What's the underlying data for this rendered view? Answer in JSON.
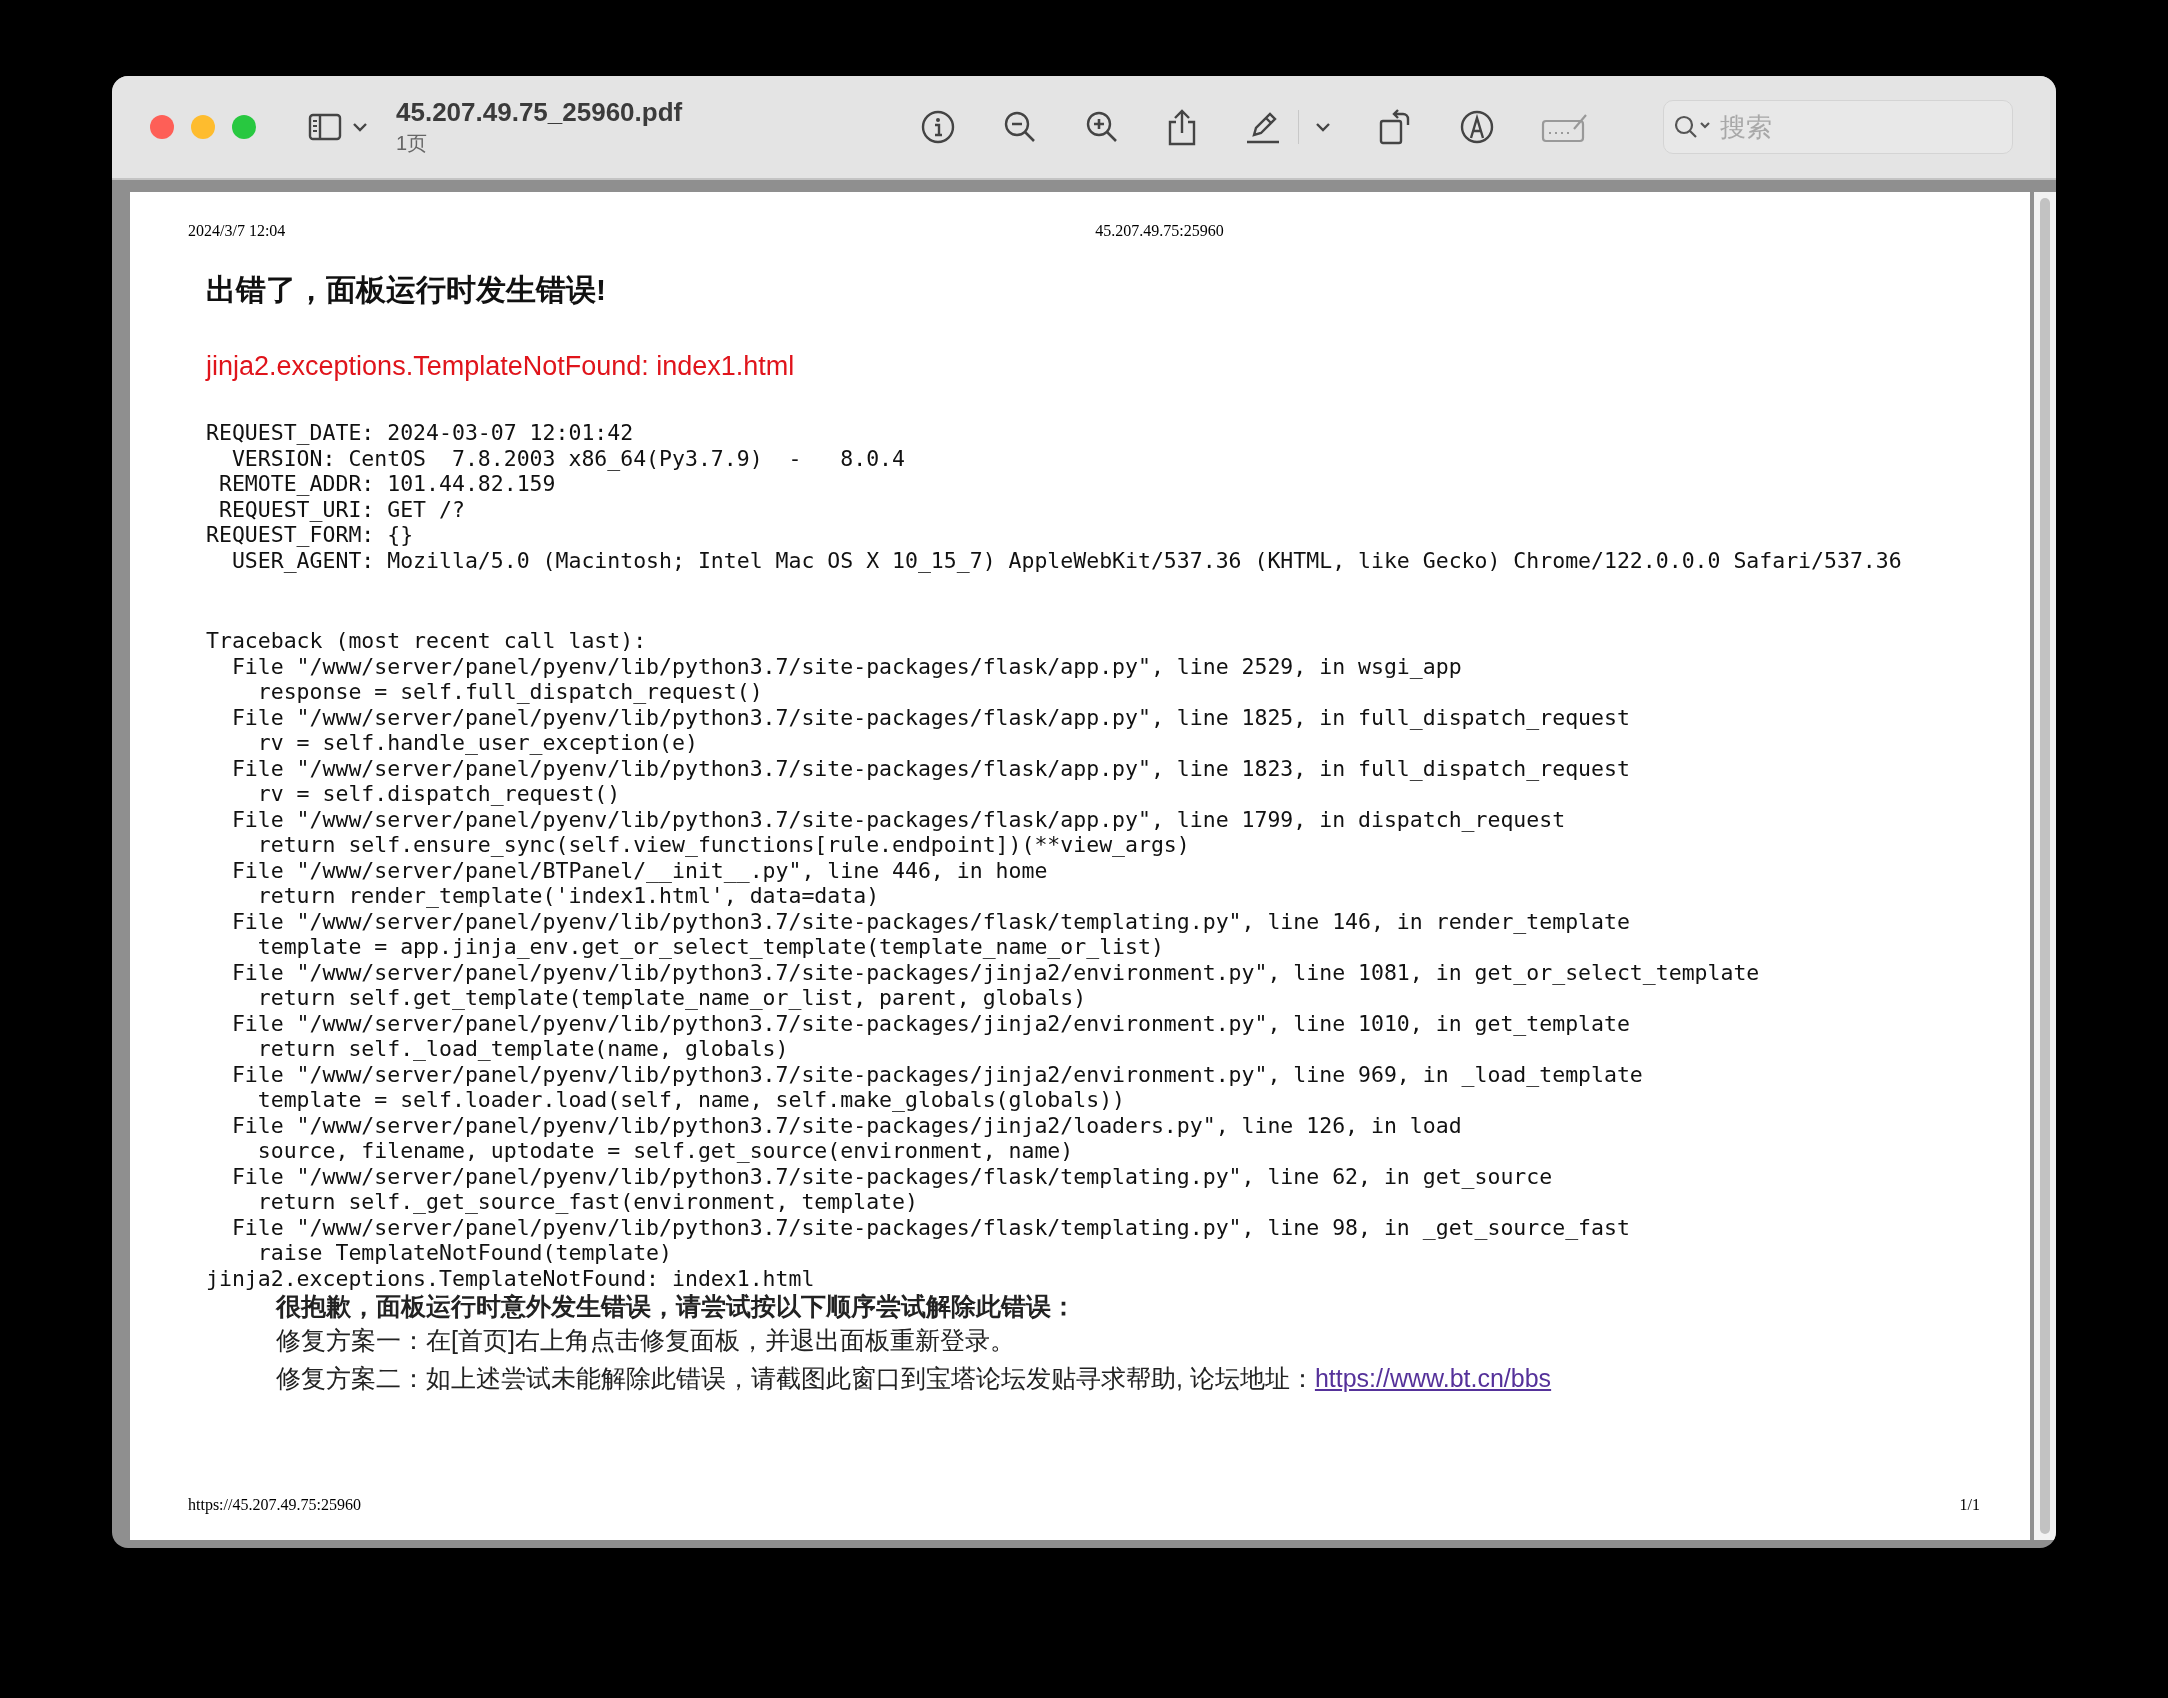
{
  "window": {
    "title": "45.207.49.75_25960.pdf",
    "subtitle": "1页"
  },
  "toolbar": {
    "search": {
      "placeholder": "搜索"
    }
  },
  "page": {
    "header_left": "2024/3/7 12:04",
    "header_center": "45.207.49.75:25960",
    "title": "出错了，面板运行时发生错误!",
    "error": "jinja2.exceptions.TemplateNotFound: index1.html",
    "request_info": [
      "REQUEST_DATE: 2024-03-07 12:01:42",
      "  VERSION: CentOS  7.8.2003 x86_64(Py3.7.9)  -   8.0.4",
      " REMOTE_ADDR: 101.44.82.159",
      " REQUEST_URI: GET /?",
      "REQUEST_FORM: {}",
      "  USER_AGENT: Mozilla/5.0 (Macintosh; Intel Mac OS X 10_15_7) AppleWebKit/537.36 (KHTML, like Gecko) Chrome/122.0.0.0 Safari/537.36"
    ],
    "traceback": [
      "Traceback (most recent call last):",
      "  File \"/www/server/panel/pyenv/lib/python3.7/site-packages/flask/app.py\", line 2529, in wsgi_app",
      "    response = self.full_dispatch_request()",
      "  File \"/www/server/panel/pyenv/lib/python3.7/site-packages/flask/app.py\", line 1825, in full_dispatch_request",
      "    rv = self.handle_user_exception(e)",
      "  File \"/www/server/panel/pyenv/lib/python3.7/site-packages/flask/app.py\", line 1823, in full_dispatch_request",
      "    rv = self.dispatch_request()",
      "  File \"/www/server/panel/pyenv/lib/python3.7/site-packages/flask/app.py\", line 1799, in dispatch_request",
      "    return self.ensure_sync(self.view_functions[rule.endpoint])(**view_args)",
      "  File \"/www/server/panel/BTPanel/__init__.py\", line 446, in home",
      "    return render_template('index1.html', data=data)",
      "  File \"/www/server/panel/pyenv/lib/python3.7/site-packages/flask/templating.py\", line 146, in render_template",
      "    template = app.jinja_env.get_or_select_template(template_name_or_list)",
      "  File \"/www/server/panel/pyenv/lib/python3.7/site-packages/jinja2/environment.py\", line 1081, in get_or_select_template",
      "    return self.get_template(template_name_or_list, parent, globals)",
      "  File \"/www/server/panel/pyenv/lib/python3.7/site-packages/jinja2/environment.py\", line 1010, in get_template",
      "    return self._load_template(name, globals)",
      "  File \"/www/server/panel/pyenv/lib/python3.7/site-packages/jinja2/environment.py\", line 969, in _load_template",
      "    template = self.loader.load(self, name, self.make_globals(globals))",
      "  File \"/www/server/panel/pyenv/lib/python3.7/site-packages/jinja2/loaders.py\", line 126, in load",
      "    source, filename, uptodate = self.get_source(environment, name)",
      "  File \"/www/server/panel/pyenv/lib/python3.7/site-packages/flask/templating.py\", line 62, in get_source",
      "    return self._get_source_fast(environment, template)",
      "  File \"/www/server/panel/pyenv/lib/python3.7/site-packages/flask/templating.py\", line 98, in _get_source_fast",
      "    raise TemplateNotFound(template)",
      "jinja2.exceptions.TemplateNotFound: index1.html"
    ],
    "help": {
      "heading": "很抱歉，面板运行时意外发生错误，请尝试按以下顺序尝试解除此错误：",
      "lines": [
        {
          "text": "修复方案一：在[首页]右上角点击修复面板，并退出面板重新登录。"
        },
        {
          "text": "修复方案二：如上述尝试未能解除此错误，请截图此窗口到宝塔论坛发贴寻求帮助, 论坛地址：",
          "link": "https://www.bt.cn/bbs"
        }
      ]
    },
    "footer_left": "https://45.207.49.75:25960",
    "footer_right": "1/1"
  }
}
